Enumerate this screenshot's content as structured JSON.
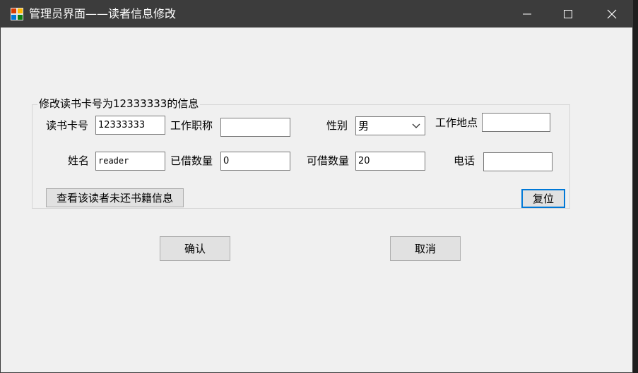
{
  "window": {
    "title": "管理员界面——读者信息修改",
    "controls": {
      "minimize": "minimize-icon",
      "maximize": "maximize-icon",
      "close": "close-icon"
    }
  },
  "form": {
    "group_title": "修改读书卡号为12333333的信息",
    "card_no": {
      "label": "读书卡号",
      "value": "12333333"
    },
    "job_title": {
      "label": "工作职称",
      "value": ""
    },
    "gender": {
      "label": "性别",
      "value": "男"
    },
    "workplace": {
      "label": "工作地点",
      "value": ""
    },
    "name": {
      "label": "姓名",
      "value": "reader"
    },
    "borrowed": {
      "label": "已借数量",
      "value": "0"
    },
    "can_borrow": {
      "label": "可借数量",
      "value": "20"
    },
    "phone": {
      "label": "电话",
      "value": ""
    }
  },
  "buttons": {
    "view_unreturned": "查看该读者未还书籍信息",
    "reset": "复位",
    "confirm": "确认",
    "cancel": "取消"
  },
  "colors": {
    "titlebar": "#3c3c3c",
    "background": "#f0f0f0",
    "focus": "#0078d7"
  }
}
